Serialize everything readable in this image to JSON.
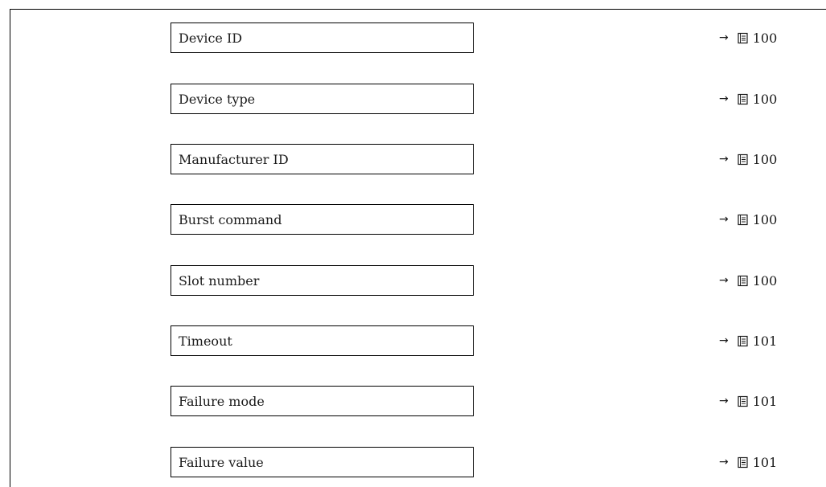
{
  "rows": [
    {
      "label": "Device ID",
      "page": "100",
      "arrow": "→",
      "icon": "book-icon"
    },
    {
      "label": "Device type",
      "page": "100",
      "arrow": "→",
      "icon": "book-icon"
    },
    {
      "label": "Manufacturer ID",
      "page": "100",
      "arrow": "→",
      "icon": "book-icon"
    },
    {
      "label": "Burst command",
      "page": "100",
      "arrow": "→",
      "icon": "book-icon"
    },
    {
      "label": "Slot number",
      "page": "100",
      "arrow": "→",
      "icon": "book-icon"
    },
    {
      "label": "Timeout",
      "page": "101",
      "arrow": "→",
      "icon": "book-icon"
    },
    {
      "label": "Failure mode",
      "page": "101",
      "arrow": "→",
      "icon": "book-icon"
    },
    {
      "label": "Failure value",
      "page": "101",
      "arrow": "→",
      "icon": "book-icon"
    }
  ]
}
